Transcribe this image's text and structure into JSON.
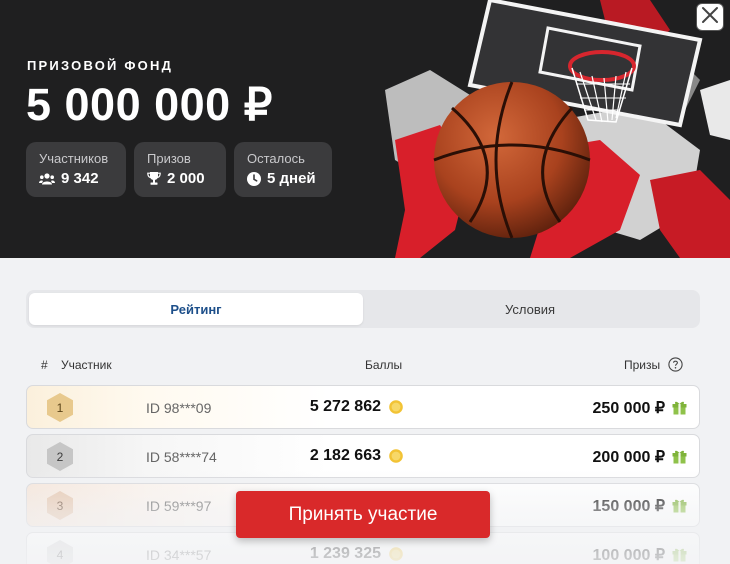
{
  "hero": {
    "fund_label": "ПРИЗОВОЙ ФОНД",
    "fund_amount": "5 000 000 ₽",
    "stats": [
      {
        "label": "Участников",
        "value": "9 342",
        "icon": "users-icon"
      },
      {
        "label": "Призов",
        "value": "2 000",
        "icon": "trophy-icon"
      },
      {
        "label": "Осталось",
        "value": "5 дней",
        "icon": "clock-icon"
      }
    ]
  },
  "tabs": [
    {
      "label": "Рейтинг",
      "active": true
    },
    {
      "label": "Условия",
      "active": false
    }
  ],
  "table": {
    "headers": {
      "rank": "#",
      "participant": "Участник",
      "points": "Баллы",
      "prizes": "Призы"
    },
    "rows": [
      {
        "rank": "1",
        "id": "ID 98***09",
        "points": "5 272 862",
        "prize": "250 000 ₽",
        "medal": "gold"
      },
      {
        "rank": "2",
        "id": "ID 58****74",
        "points": "2 182 663",
        "prize": "200 000 ₽",
        "medal": "silver"
      },
      {
        "rank": "3",
        "id": "ID 59***97",
        "points": "",
        "prize": "150 000 ₽",
        "medal": "bronze"
      },
      {
        "rank": "4",
        "id": "ID 34***57",
        "points": "1 239 325",
        "prize": "100 000 ₽",
        "medal": "plain"
      }
    ]
  },
  "cta": {
    "label": "Принять участие"
  },
  "colors": {
    "accent_red": "#d9292a",
    "active_tab_text": "#1d4f8a",
    "hero_bg": "#1f1f20",
    "gold": "#e8c98d",
    "silver": "#c6c6c6",
    "bronze": "#e7c8b0"
  }
}
